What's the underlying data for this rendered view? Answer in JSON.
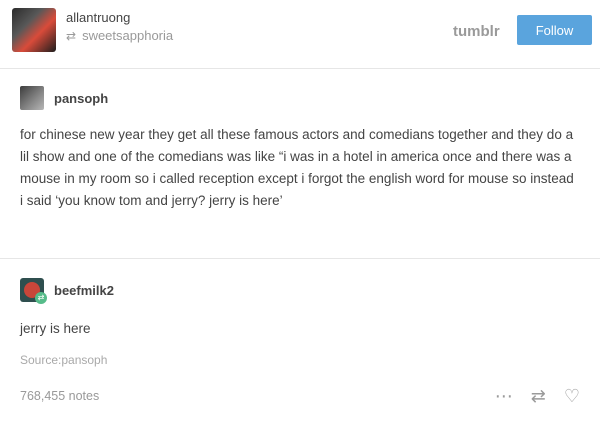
{
  "header": {
    "username": "allantruong",
    "reblogged_from": "sweetsapphoria",
    "brand": "tumblr",
    "follow_label": "Follow"
  },
  "posts": [
    {
      "blog": "pansoph",
      "text": "for chinese new year they get all these famous actors and comedians together and they do a lil show and one of the comedians was like “i was in a hotel in america once and there was a mouse in my room so i called reception except i forgot the english word for mouse so instead i said ‘you know tom and jerry? jerry is here’"
    },
    {
      "blog": "beefmilk2",
      "text": "jerry is here"
    }
  ],
  "source": "Source:pansoph",
  "footer": {
    "notes": "768,455 notes",
    "icons": [
      "more-icon",
      "reblog-icon",
      "heart-icon"
    ]
  },
  "colors": {
    "follow_button": "#5aa4dd",
    "reblog_badge": "#56bc8a",
    "text": "#444444",
    "muted": "#999999"
  }
}
